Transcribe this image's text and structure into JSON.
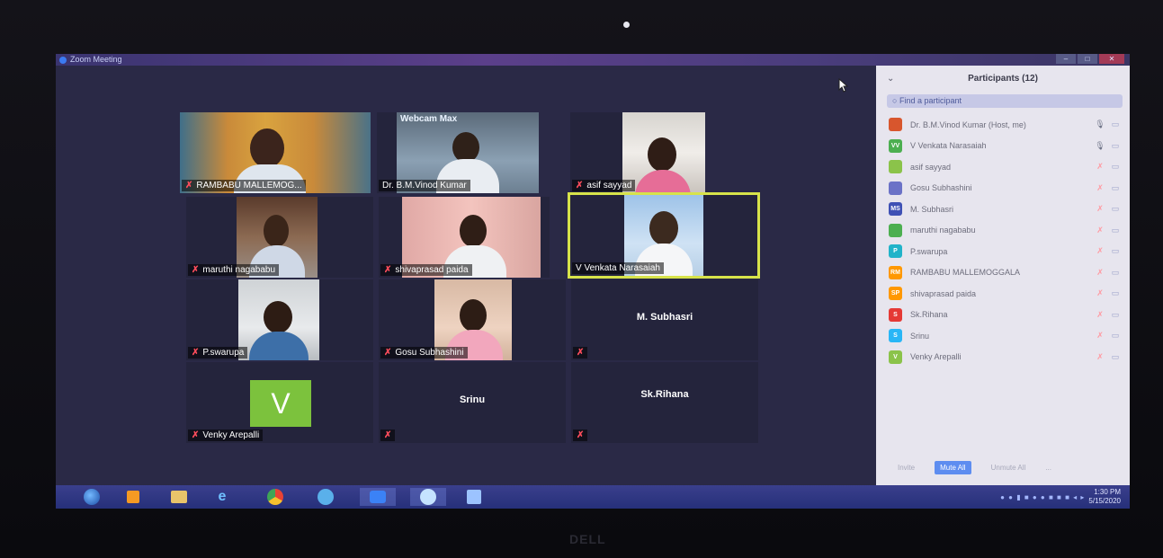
{
  "window": {
    "title": "Zoom Meeting",
    "controls": [
      "–",
      "□",
      "✕"
    ]
  },
  "colors": {
    "brand": "#2d8cff",
    "mute": "#ff4d5c",
    "active_speaker": "#d7e34a",
    "avatar_green": "#7cc23d"
  },
  "video_grid": {
    "tiles": [
      {
        "name": "RAMBABU MALLEMOG...",
        "muted": true
      },
      {
        "name": "Dr. B.M.Vinod Kumar",
        "muted": false,
        "overlay": "Webcam Max"
      },
      {
        "name": "asif sayyad",
        "muted": true
      },
      {
        "name": "maruthi nagababu",
        "muted": true
      },
      {
        "name": "shivaprasad paida",
        "muted": true
      },
      {
        "name": "V Venkata Narasaiah",
        "muted": false,
        "active": true
      },
      {
        "name": "P.swarupa",
        "muted": true
      },
      {
        "name": "Gosu Subhashini",
        "muted": true
      },
      {
        "name": "M. Subhasri",
        "muted": true,
        "no_video": true
      },
      {
        "name": "Venky Arepalli",
        "muted": true,
        "avatar_letter": "V"
      },
      {
        "name": "Srinu",
        "muted": true,
        "no_video": true
      },
      {
        "name": "Sk.Rihana",
        "muted": true,
        "no_video": true
      }
    ]
  },
  "participants_panel": {
    "title": "Participants (12)",
    "search_placeholder": "Find a participant",
    "items": [
      {
        "name": "Dr. B.M.Vinod Kumar (Host, me)",
        "avatar": "",
        "avatar_color": "#d8562d",
        "mic": "on"
      },
      {
        "name": "V Venkata Narasaiah",
        "avatar": "VV",
        "avatar_color": "#4caf50",
        "mic": "on"
      },
      {
        "name": "asif sayyad",
        "avatar": "",
        "avatar_color": "#8bc34a",
        "mic": "off"
      },
      {
        "name": "Gosu Subhashini",
        "avatar": "",
        "avatar_color": "#6b72c7",
        "mic": "off"
      },
      {
        "name": "M. Subhasri",
        "avatar": "MS",
        "avatar_color": "#3f51b5",
        "mic": "off"
      },
      {
        "name": "maruthi nagababu",
        "avatar": "",
        "avatar_color": "#4caf50",
        "mic": "off"
      },
      {
        "name": "P.swarupa",
        "avatar": "P",
        "avatar_color": "#21b3c9",
        "mic": "off"
      },
      {
        "name": "RAMBABU MALLEMOGGALA",
        "avatar": "RM",
        "avatar_color": "#ff9800",
        "mic": "off"
      },
      {
        "name": "shivaprasad paida",
        "avatar": "SP",
        "avatar_color": "#ff9800",
        "mic": "off"
      },
      {
        "name": "Sk.Rihana",
        "avatar": "S",
        "avatar_color": "#e53935",
        "mic": "off"
      },
      {
        "name": "Srinu",
        "avatar": "S",
        "avatar_color": "#29b6f6",
        "mic": "off"
      },
      {
        "name": "Venky Arepalli",
        "avatar": "V",
        "avatar_color": "#8bc34a",
        "mic": "off"
      }
    ],
    "footer": {
      "invite": "Invite",
      "mute_all": "Mute All",
      "unmute_all": "Unmute All",
      "more": "..."
    }
  },
  "taskbar": {
    "time": "1:30 PM",
    "date": "5/15/2020"
  },
  "brand_logo": "DELL"
}
